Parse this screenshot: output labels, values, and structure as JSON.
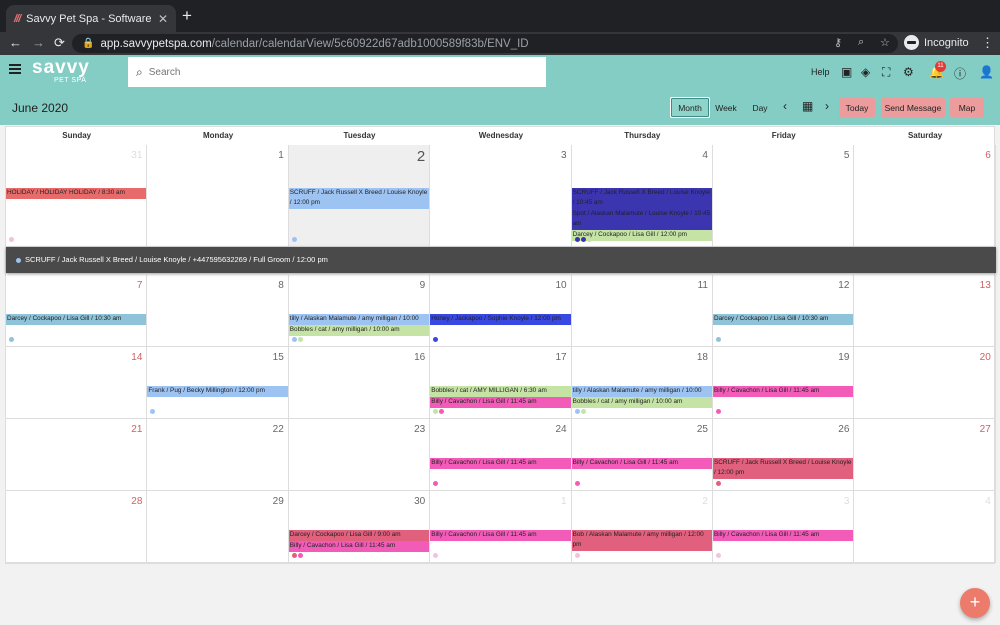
{
  "browser": {
    "tab_title": "Savvy Pet Spa - Software",
    "tab_close": "✕",
    "new_tab": "+",
    "url_host": "app.savvypetspa.com",
    "url_path": "/calendar/calendarView/5c60922d67adb1000589f83b/ENV_ID",
    "incognito_label": "Incognito"
  },
  "app": {
    "logo_main": "savvy",
    "logo_sub": "PET SPA",
    "search_placeholder": "Search",
    "help_label": "Help",
    "notifications_count": "11"
  },
  "toolbar": {
    "title": "June 2020",
    "month_label": "Month",
    "week_label": "Week",
    "day_label": "Day",
    "prev_icon": "‹",
    "next_icon": "›",
    "today_label": "Today",
    "send_message_label": "Send Message",
    "map_label": "Map"
  },
  "calendar": {
    "weekdays": [
      "Sunday",
      "Monday",
      "Tuesday",
      "Wednesday",
      "Thursday",
      "Friday",
      "Saturday"
    ],
    "weeks": [
      {
        "days": [
          {
            "num": "31",
            "other": true,
            "weekend": true,
            "events": [
              {
                "text": "HOLIDAY / HOLIDAY HOLIDAY / 8:30 am",
                "color": "c-red"
              }
            ],
            "dots": [
              "#f5c2cf"
            ]
          },
          {
            "num": "1",
            "events": [],
            "dots": []
          },
          {
            "num": "2",
            "today": true,
            "events": [
              {
                "text": "SCRUFF / Jack Russell X Breed / Louise Knoyle / 12:00 pm",
                "color": "c-blue",
                "lines": 2
              }
            ],
            "dots": [
              "#9dc3f3"
            ]
          },
          {
            "num": "3",
            "events": [],
            "dots": []
          },
          {
            "num": "4",
            "events": [
              {
                "text": "SCRUFF / Jack Russell X Breed / Louise Knoyle / 10:45 am",
                "color": "c-navy",
                "lines": 2
              },
              {
                "text": "Spot / Alaskan Malamute / Louise Knoyle / 10:45 am",
                "color": "c-navy",
                "lines": 2
              },
              {
                "text": "Darcey / Cockapoo / Lisa Gill / 12:00 pm",
                "color": "c-green"
              }
            ],
            "dots": [
              "#3b35b0",
              "#3b35b0",
              "#c5e3a5"
            ]
          },
          {
            "num": "5",
            "events": [],
            "dots": []
          },
          {
            "num": "6",
            "weekend": true,
            "events": [],
            "dots": []
          }
        ]
      },
      {
        "days": [
          {
            "num": "7",
            "weekend": true,
            "events": [
              {
                "text": "Darcey / Cockapoo / Lisa Gill / 10:30 am",
                "color": "c-sky"
              }
            ],
            "dots": [
              "#8ec3da"
            ]
          },
          {
            "num": "8",
            "events": [],
            "dots": []
          },
          {
            "num": "9",
            "events": [
              {
                "text": "tilly / Alaskan Malamute / amy milligan / 10:00 am",
                "color": "c-blue"
              },
              {
                "text": "Bobbles / cat / amy milligan / 10:00 am",
                "color": "c-green"
              }
            ],
            "dots": [
              "#9dc3f3",
              "#c5e3a5"
            ]
          },
          {
            "num": "10",
            "events": [
              {
                "text": "Honey / Jackapoo / Sophie Knoyle / 12:00 pm",
                "color": "c-royal"
              }
            ],
            "dots": [
              "#3848e0"
            ]
          },
          {
            "num": "11",
            "events": [],
            "dots": []
          },
          {
            "num": "12",
            "events": [
              {
                "text": "Darcey / Cockapoo / Lisa Gill / 10:30 am",
                "color": "c-sky"
              }
            ],
            "dots": [
              "#8ec3da"
            ]
          },
          {
            "num": "13",
            "weekend": true,
            "events": [],
            "dots": []
          }
        ]
      },
      {
        "days": [
          {
            "num": "14",
            "weekend": true,
            "events": [],
            "dots": []
          },
          {
            "num": "15",
            "events": [
              {
                "text": "Frank / Pug / Becky Millington / 12:00 pm",
                "color": "c-blue"
              }
            ],
            "dots": [
              "#9dc3f3"
            ]
          },
          {
            "num": "16",
            "events": [],
            "dots": []
          },
          {
            "num": "17",
            "events": [
              {
                "text": "Bobbles / cat / AMY MILLIGAN / 6:30 am",
                "color": "c-green"
              },
              {
                "text": "Billy / Cavachon / Lisa Gill / 11:45 am",
                "color": "c-mag"
              }
            ],
            "dots": [
              "#c5e3a5",
              "#f25cb8"
            ]
          },
          {
            "num": "18",
            "events": [
              {
                "text": "tilly / Alaskan Malamute / amy milligan / 10:00 am",
                "color": "c-blue"
              },
              {
                "text": "Bobbles / cat / amy milligan / 10:00 am",
                "color": "c-green"
              }
            ],
            "dots": [
              "#9dc3f3",
              "#c5e3a5"
            ]
          },
          {
            "num": "19",
            "events": [
              {
                "text": "Billy / Cavachon / Lisa Gill / 11:45 am",
                "color": "c-mag"
              }
            ],
            "dots": [
              "#f25cb8"
            ]
          },
          {
            "num": "20",
            "weekend": true,
            "events": [],
            "dots": []
          }
        ]
      },
      {
        "days": [
          {
            "num": "21",
            "weekend": true,
            "events": [],
            "dots": []
          },
          {
            "num": "22",
            "events": [],
            "dots": []
          },
          {
            "num": "23",
            "events": [],
            "dots": []
          },
          {
            "num": "24",
            "events": [
              {
                "text": "Billy / Cavachon / Lisa Gill / 11:45 am",
                "color": "c-mag"
              }
            ],
            "dots": [
              "#f25cb8"
            ]
          },
          {
            "num": "25",
            "events": [
              {
                "text": "Billy / Cavachon / Lisa Gill / 11:45 am",
                "color": "c-mag"
              }
            ],
            "dots": [
              "#f25cb8"
            ]
          },
          {
            "num": "26",
            "events": [
              {
                "text": "SCRUFF / Jack Russell X Breed / Louise Knoyle / 12:00 pm",
                "color": "c-rose",
                "lines": 2
              }
            ],
            "dots": [
              "#e0607d"
            ]
          },
          {
            "num": "27",
            "weekend": true,
            "events": [],
            "dots": []
          }
        ]
      },
      {
        "days": [
          {
            "num": "28",
            "weekend": true,
            "events": [],
            "dots": []
          },
          {
            "num": "29",
            "events": [],
            "dots": []
          },
          {
            "num": "30",
            "events": [
              {
                "text": "Darcey / Cockapoo / Lisa Gill / 9:00 am",
                "color": "c-rose"
              },
              {
                "text": "Billy / Cavachon / Lisa Gill / 11:45 am",
                "color": "c-mag"
              }
            ],
            "dots": [
              "#e0607d",
              "#f25cb8"
            ]
          },
          {
            "num": "1",
            "other": true,
            "events": [
              {
                "text": "Billy / Cavachon / Lisa Gill / 11:45 am",
                "color": "c-mag"
              }
            ],
            "dots": [
              "#f5c2dd"
            ]
          },
          {
            "num": "2",
            "other": true,
            "events": [
              {
                "text": "Bob / Alaskan Malamute / amy milligan / 12:00 pm",
                "color": "c-rose",
                "lines": 2
              }
            ],
            "dots": [
              "#f5c2dd"
            ]
          },
          {
            "num": "3",
            "other": true,
            "events": [
              {
                "text": "Billy / Cavachon / Lisa Gill / 11:45 am",
                "color": "c-mag"
              }
            ],
            "dots": [
              "#f5c2dd"
            ]
          },
          {
            "num": "4",
            "other": true,
            "weekend": true,
            "events": [],
            "dots": []
          }
        ]
      }
    ],
    "detail_bar": "SCRUFF / Jack Russell X Breed / Louise Knoyle / +447595632269 / Full Groom / 12:00 pm"
  },
  "fab_label": "+"
}
